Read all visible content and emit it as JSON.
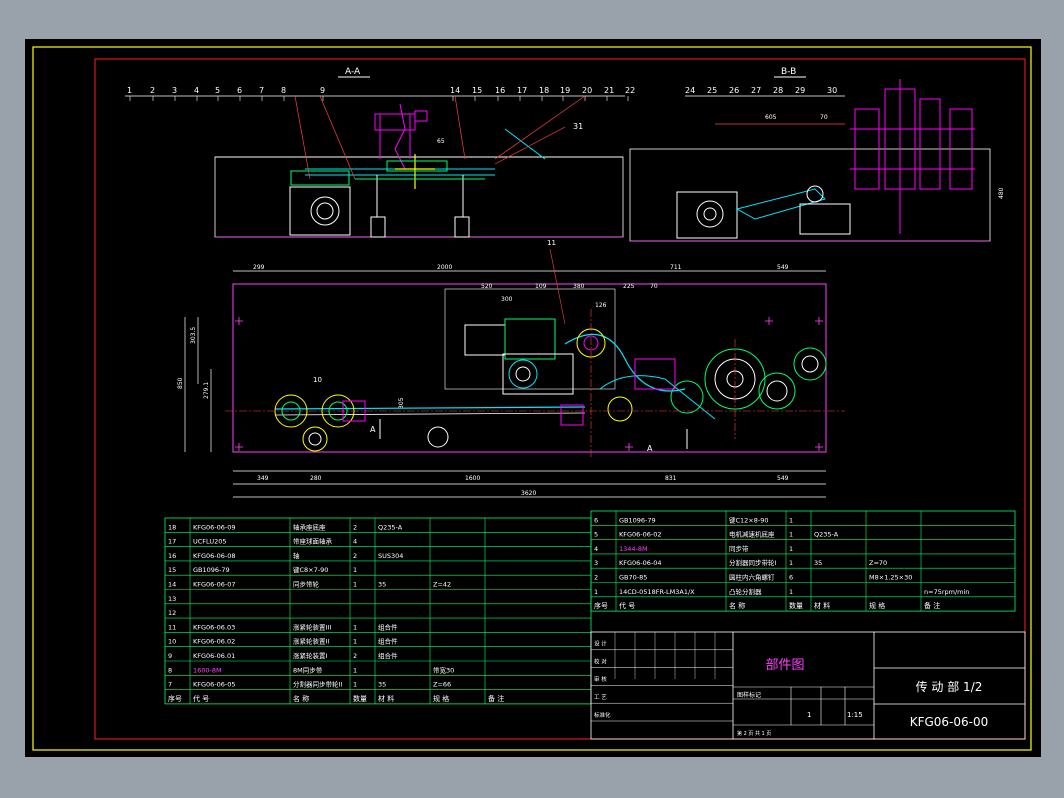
{
  "colors": {
    "background": "#000000",
    "frame": "#ffff00",
    "border": "#ff2020",
    "lines": "#ffffff",
    "dims": "#e040e0",
    "green": "#00ff66",
    "cyan": "#00e5ff",
    "magenta": "#ff00ff"
  },
  "views": {
    "section_aa": "A-A",
    "section_bb": "B-B",
    "marker_a": "A",
    "marker_a2": "A",
    "balloons_left": [
      "1",
      "2",
      "3",
      "4",
      "5",
      "6",
      "7",
      "8",
      "9",
      "14",
      "15",
      "16",
      "17",
      "18",
      "19",
      "20",
      "21",
      "22",
      "31"
    ],
    "balloons_right": [
      "24",
      "25",
      "26",
      "27",
      "28",
      "29",
      "30"
    ],
    "plan_balloons": [
      "10",
      "11"
    ]
  },
  "dimensions": {
    "top_row": [
      "299",
      "2000",
      "711",
      "549"
    ],
    "mid_row": [
      "520",
      "300",
      "109",
      "380",
      "225",
      "70",
      "126"
    ],
    "bottom_row": [
      "349",
      "280",
      "1600",
      "831",
      "549"
    ],
    "overall": "3620",
    "left": [
      "850",
      "303.5",
      "279.1"
    ],
    "mid_left": "305",
    "right_view": [
      "605",
      "70",
      "480",
      "65"
    ]
  },
  "bom_left": {
    "headers": [
      "序号",
      "代  号",
      "名  称",
      "数量",
      "材 料",
      "规 格",
      "备  注"
    ],
    "rows": [
      {
        "no": "18",
        "code": "KFG06-06-09",
        "name": "轴承座底座",
        "qty": "2",
        "mat": "Q235-A",
        "spec": "",
        "note": ""
      },
      {
        "no": "17",
        "code": "UCFLU205",
        "name": "带座球面轴承",
        "qty": "4",
        "mat": "",
        "spec": "",
        "note": ""
      },
      {
        "no": "16",
        "code": "KFG06-06-08",
        "name": "轴",
        "qty": "2",
        "mat": "SUS304",
        "spec": "",
        "note": ""
      },
      {
        "no": "15",
        "code": "GB1096-79",
        "name": "键C8×7-90",
        "qty": "1",
        "mat": "",
        "spec": "",
        "note": ""
      },
      {
        "no": "14",
        "code": "KFG06-06-07",
        "name": "同步带轮",
        "qty": "1",
        "mat": "35",
        "spec": "Z=42",
        "note": ""
      },
      {
        "no": "13",
        "code": "",
        "name": "",
        "qty": "",
        "mat": "",
        "spec": "",
        "note": ""
      },
      {
        "no": "12",
        "code": "",
        "name": "",
        "qty": "",
        "mat": "",
        "spec": "",
        "note": ""
      },
      {
        "no": "11",
        "code": "KFG06-06.03",
        "name": "涨紧轮装置III",
        "qty": "1",
        "mat": "组合件",
        "spec": "",
        "note": ""
      },
      {
        "no": "10",
        "code": "KFG06-06.02",
        "name": "涨紧轮装置II",
        "qty": "1",
        "mat": "组合件",
        "spec": "",
        "note": ""
      },
      {
        "no": "9",
        "code": "KFG06-06.01",
        "name": "涨紧轮装置I",
        "qty": "2",
        "mat": "组合件",
        "spec": "",
        "note": ""
      },
      {
        "no": "8",
        "code": "1600-8M",
        "name": "8M同步带",
        "qty": "1",
        "mat": "",
        "spec": "带宽30",
        "note": ""
      },
      {
        "no": "7",
        "code": "KFG06-06-05",
        "name": "分割器同步带轮II",
        "qty": "1",
        "mat": "35",
        "spec": "Z=66",
        "note": ""
      }
    ]
  },
  "bom_right": {
    "rows": [
      {
        "no": "6",
        "code": "GB1096-79",
        "name": "键C12×8-90",
        "qty": "1",
        "mat": "",
        "spec": "",
        "note": ""
      },
      {
        "no": "5",
        "code": "KFG06-06-02",
        "name": "电机减速机底座",
        "qty": "1",
        "mat": "Q235-A",
        "spec": "",
        "note": ""
      },
      {
        "no": "4",
        "code": "1344-8M",
        "name": "同步带",
        "qty": "1",
        "mat": "",
        "spec": "",
        "note": ""
      },
      {
        "no": "3",
        "code": "KFG06-06-04",
        "name": "分割器同步带轮I",
        "qty": "1",
        "mat": "35",
        "spec": "Z=70",
        "note": ""
      },
      {
        "no": "2",
        "code": "GB70-85",
        "name": "圆柱内六角螺钉",
        "qty": "6",
        "mat": "",
        "spec": "M8×1.25×30",
        "note": ""
      },
      {
        "no": "1",
        "code": "14CD-0518FR-LM3A1/X",
        "name": "凸轮分割器",
        "qty": "1",
        "mat": "",
        "spec": "",
        "note": "n=75rpm/min"
      }
    ],
    "headers": [
      "序号",
      "代  号",
      "名  称",
      "数量",
      "材 料",
      "规 格",
      "备  注"
    ]
  },
  "title_block": {
    "drawing_type": "部件图",
    "title": "传 动 部 1/2",
    "drawing_no": "KFG06-06-00",
    "qty": "1",
    "scale": "1:15",
    "stage_label": "图样标记",
    "sheets": "第  2  页    共  1  页",
    "roles": [
      "设 计",
      "校 对",
      "审 核",
      "工 艺",
      "标准化",
      "批 准"
    ]
  }
}
